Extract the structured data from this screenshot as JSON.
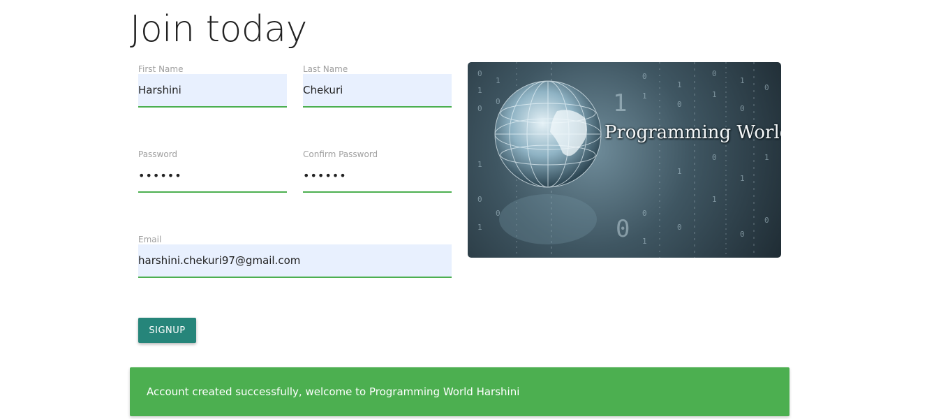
{
  "page": {
    "title": "Join today"
  },
  "form": {
    "first_name": {
      "label": "First Name",
      "value": "Harshini"
    },
    "last_name": {
      "label": "Last Name",
      "value": "Chekuri"
    },
    "password": {
      "label": "Password",
      "value": "••••••"
    },
    "confirm_password": {
      "label": "Confirm Password",
      "value": "••••••"
    },
    "email": {
      "label": "Email",
      "value": "harshini.chekuri97@gmail.com"
    },
    "submit_label": "SIGNUP"
  },
  "banner": {
    "text": "Programming World"
  },
  "toast": {
    "message": "Account created successfully, welcome to Programming World Harshini"
  },
  "colors": {
    "accent_underline": "#4caf50",
    "button": "#26857a",
    "toast": "#4caf50",
    "autofill": "#e8f0fe"
  }
}
